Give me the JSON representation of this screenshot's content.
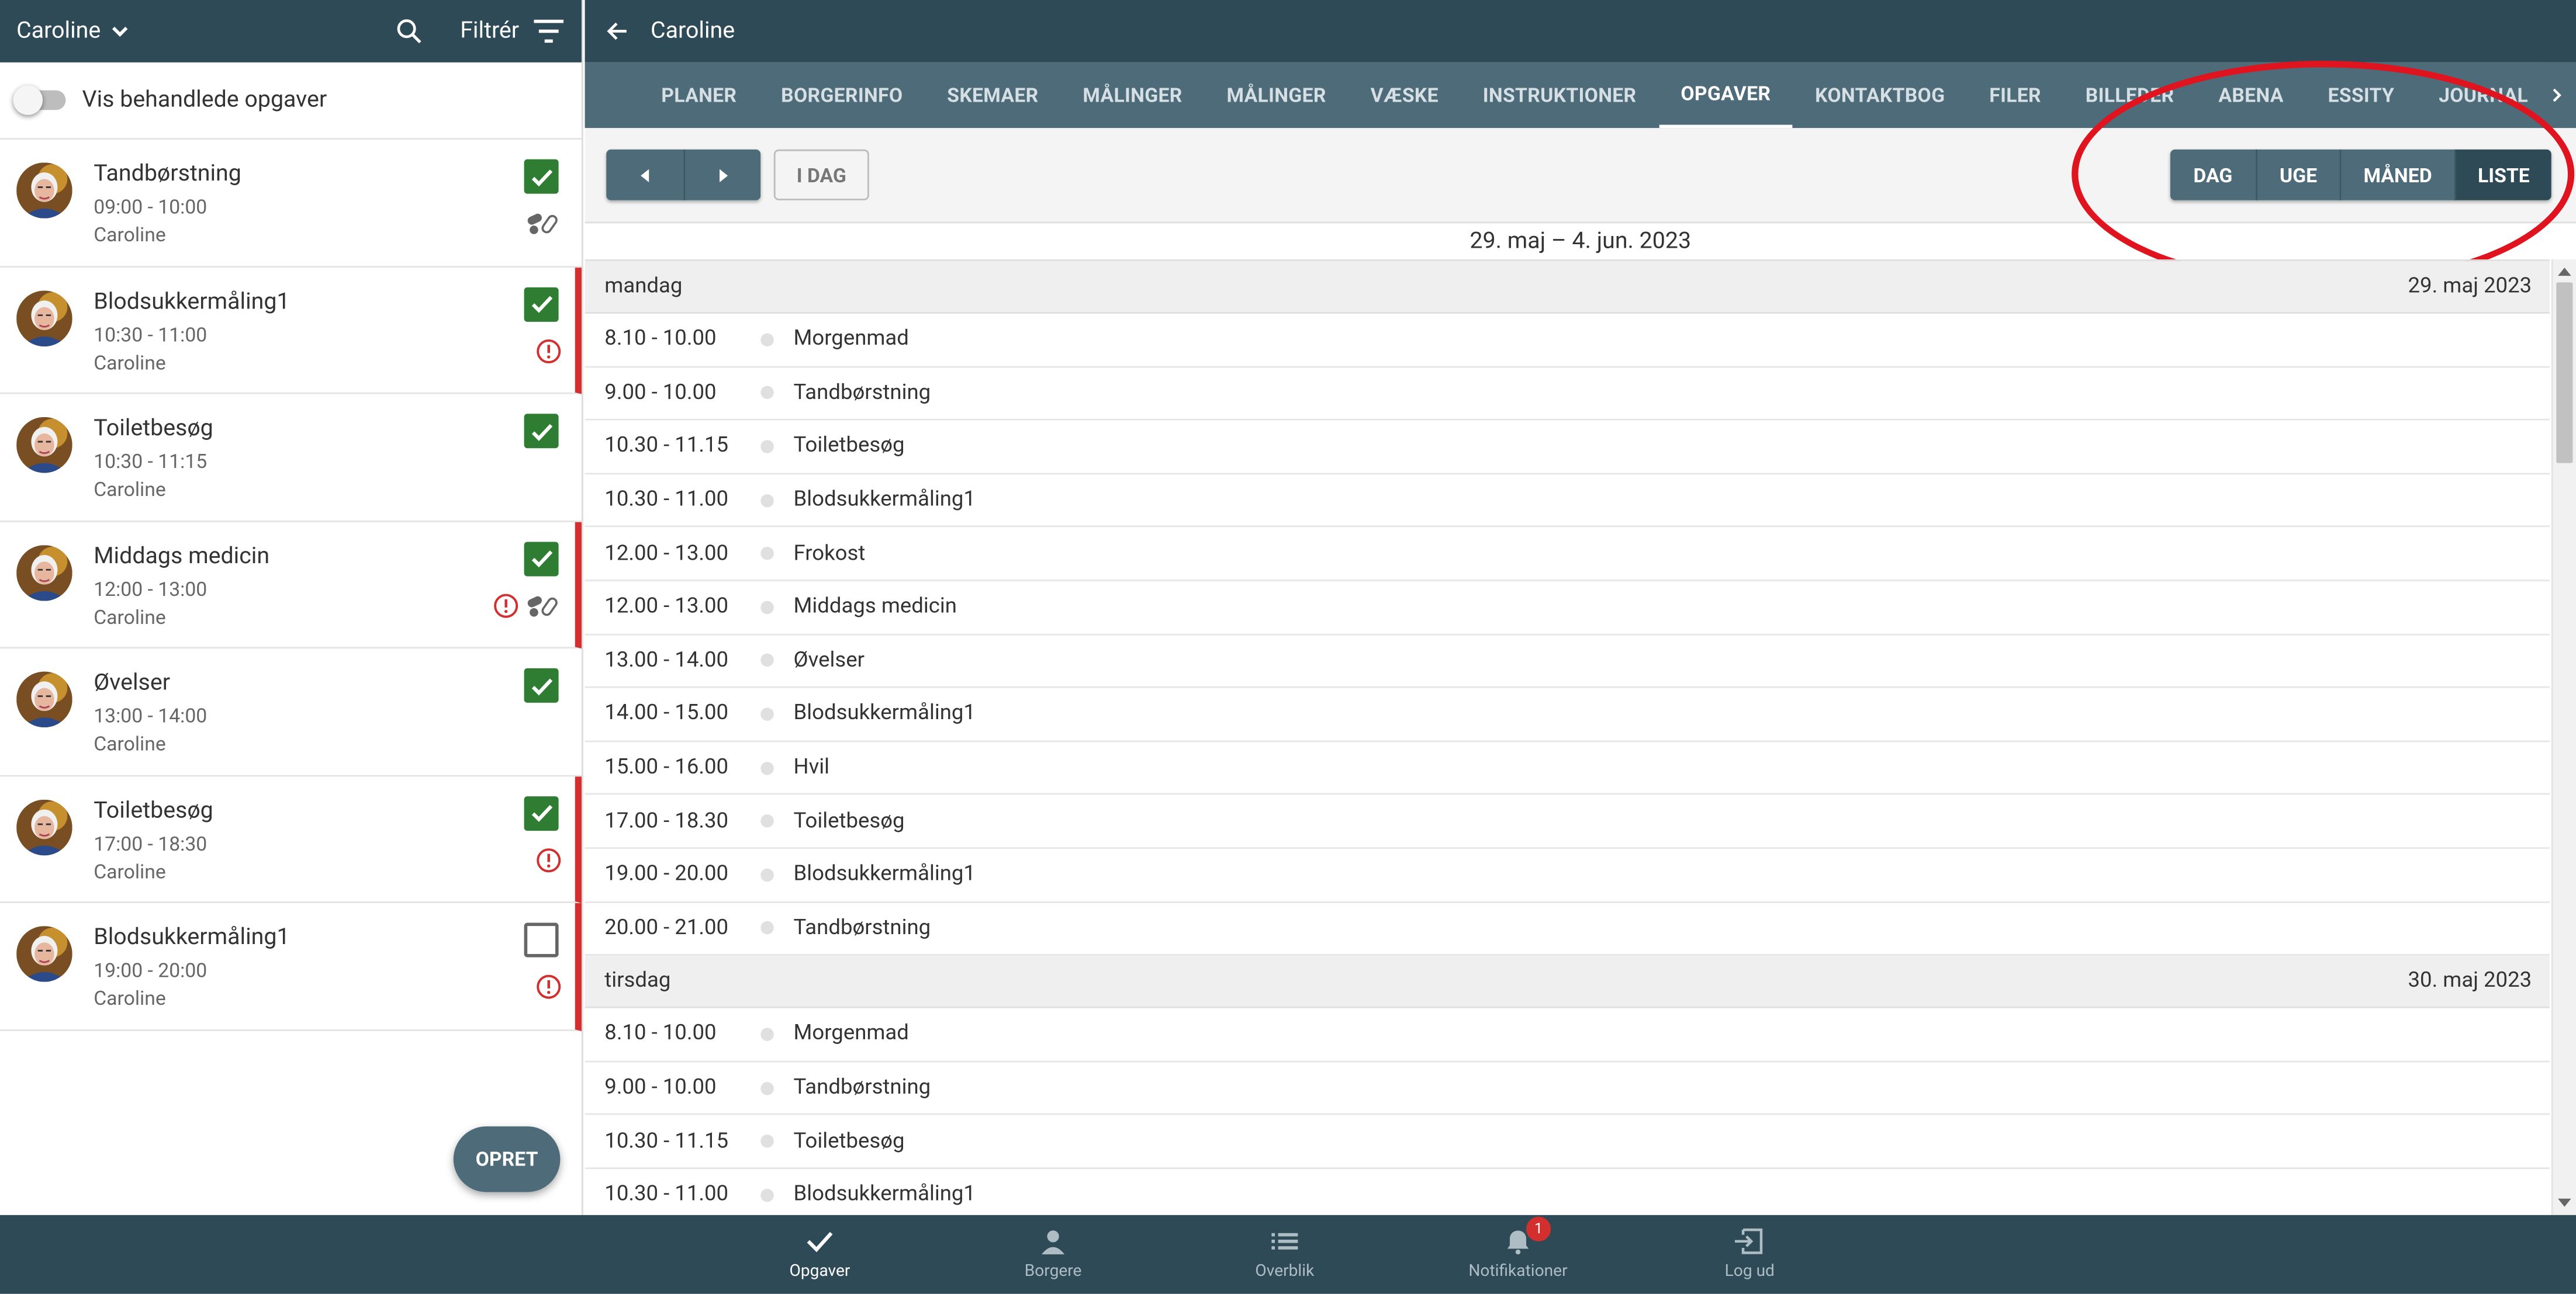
{
  "left_panel": {
    "citizen_name": "Caroline",
    "filter_label": "Filtrér",
    "toggle_label": "Vis behandlede opgaver",
    "tasks": [
      {
        "title": "Tandbørstning",
        "time": "09:00 - 10:00",
        "citizen": "Caroline",
        "checked": true,
        "flag": false,
        "icons": [
          "pills-icon"
        ]
      },
      {
        "title": "Blodsukkermåling1",
        "time": "10:30 - 11:00",
        "citizen": "Caroline",
        "checked": true,
        "flag": true,
        "icons": [
          "alert-icon"
        ]
      },
      {
        "title": "Toiletbesøg",
        "time": "10:30 - 11:15",
        "citizen": "Caroline",
        "checked": true,
        "flag": false,
        "icons": []
      },
      {
        "title": "Middags medicin",
        "time": "12:00 - 13:00",
        "citizen": "Caroline",
        "checked": true,
        "flag": true,
        "icons": [
          "alert-icon",
          "pills-icon"
        ]
      },
      {
        "title": "Øvelser",
        "time": "13:00 - 14:00",
        "citizen": "Caroline",
        "checked": true,
        "flag": false,
        "icons": []
      },
      {
        "title": "Toiletbesøg",
        "time": "17:00 - 18:30",
        "citizen": "Caroline",
        "checked": true,
        "flag": true,
        "icons": [
          "alert-icon"
        ]
      },
      {
        "title": "Blodsukkermåling1",
        "time": "19:00 - 20:00",
        "citizen": "Caroline",
        "checked": false,
        "flag": true,
        "icons": [
          "alert-icon"
        ]
      }
    ],
    "create_label": "OPRET"
  },
  "right_panel": {
    "header_title": "Caroline",
    "tabs": [
      {
        "label": "PLANER",
        "active": false
      },
      {
        "label": "BORGERINFO",
        "active": false
      },
      {
        "label": "SKEMAER",
        "active": false
      },
      {
        "label": "MÅLINGER",
        "active": false
      },
      {
        "label": "MÅLINGER",
        "active": false
      },
      {
        "label": "VÆSKE",
        "active": false
      },
      {
        "label": "INSTRUKTIONER",
        "active": false
      },
      {
        "label": "OPGAVER",
        "active": true
      },
      {
        "label": "KONTAKTBOG",
        "active": false
      },
      {
        "label": "FILER",
        "active": false
      },
      {
        "label": "BILLEDER",
        "active": false
      },
      {
        "label": "ABENA",
        "active": false
      },
      {
        "label": "ESSITY",
        "active": false
      },
      {
        "label": "JOURNAL",
        "active": false
      }
    ],
    "today_label": "I DAG",
    "views": [
      {
        "label": "DAG",
        "active": false
      },
      {
        "label": "UGE",
        "active": false
      },
      {
        "label": "MÅNED",
        "active": false
      },
      {
        "label": "LISTE",
        "active": true
      }
    ],
    "date_range": "29. maj – 4. jun. 2023",
    "days": [
      {
        "weekday": "mandag",
        "date": "29. maj 2023",
        "events": [
          {
            "time": "8.10 - 10.00",
            "title": "Morgenmad"
          },
          {
            "time": "9.00 - 10.00",
            "title": "Tandbørstning"
          },
          {
            "time": "10.30 - 11.15",
            "title": "Toiletbesøg"
          },
          {
            "time": "10.30 - 11.00",
            "title": "Blodsukkermåling1"
          },
          {
            "time": "12.00 - 13.00",
            "title": "Frokost"
          },
          {
            "time": "12.00 - 13.00",
            "title": "Middags medicin"
          },
          {
            "time": "13.00 - 14.00",
            "title": "Øvelser"
          },
          {
            "time": "14.00 - 15.00",
            "title": "Blodsukkermåling1"
          },
          {
            "time": "15.00 - 16.00",
            "title": "Hvil"
          },
          {
            "time": "17.00 - 18.30",
            "title": "Toiletbesøg"
          },
          {
            "time": "19.00 - 20.00",
            "title": "Blodsukkermåling1"
          },
          {
            "time": "20.00 - 21.00",
            "title": "Tandbørstning"
          }
        ]
      },
      {
        "weekday": "tirsdag",
        "date": "30. maj 2023",
        "events": [
          {
            "time": "8.10 - 10.00",
            "title": "Morgenmad"
          },
          {
            "time": "9.00 - 10.00",
            "title": "Tandbørstning"
          },
          {
            "time": "10.30 - 11.15",
            "title": "Toiletbesøg"
          },
          {
            "time": "10.30 - 11.00",
            "title": "Blodsukkermåling1"
          }
        ]
      }
    ]
  },
  "bottom_nav": [
    {
      "label": "Opgaver",
      "icon": "check-icon",
      "active": true
    },
    {
      "label": "Borgere",
      "icon": "person-icon",
      "active": false
    },
    {
      "label": "Overblik",
      "icon": "list-icon",
      "active": false
    },
    {
      "label": "Notifikationer",
      "icon": "bell-icon",
      "active": false,
      "badge": "1"
    },
    {
      "label": "Log ud",
      "icon": "logout-icon",
      "active": false
    }
  ],
  "colors": {
    "header": "#2f4a57",
    "tabbar": "#4d6b78",
    "check_green": "#2e7d32",
    "alert_red": "#d32f2f",
    "annotation_red": "#e0141e"
  }
}
